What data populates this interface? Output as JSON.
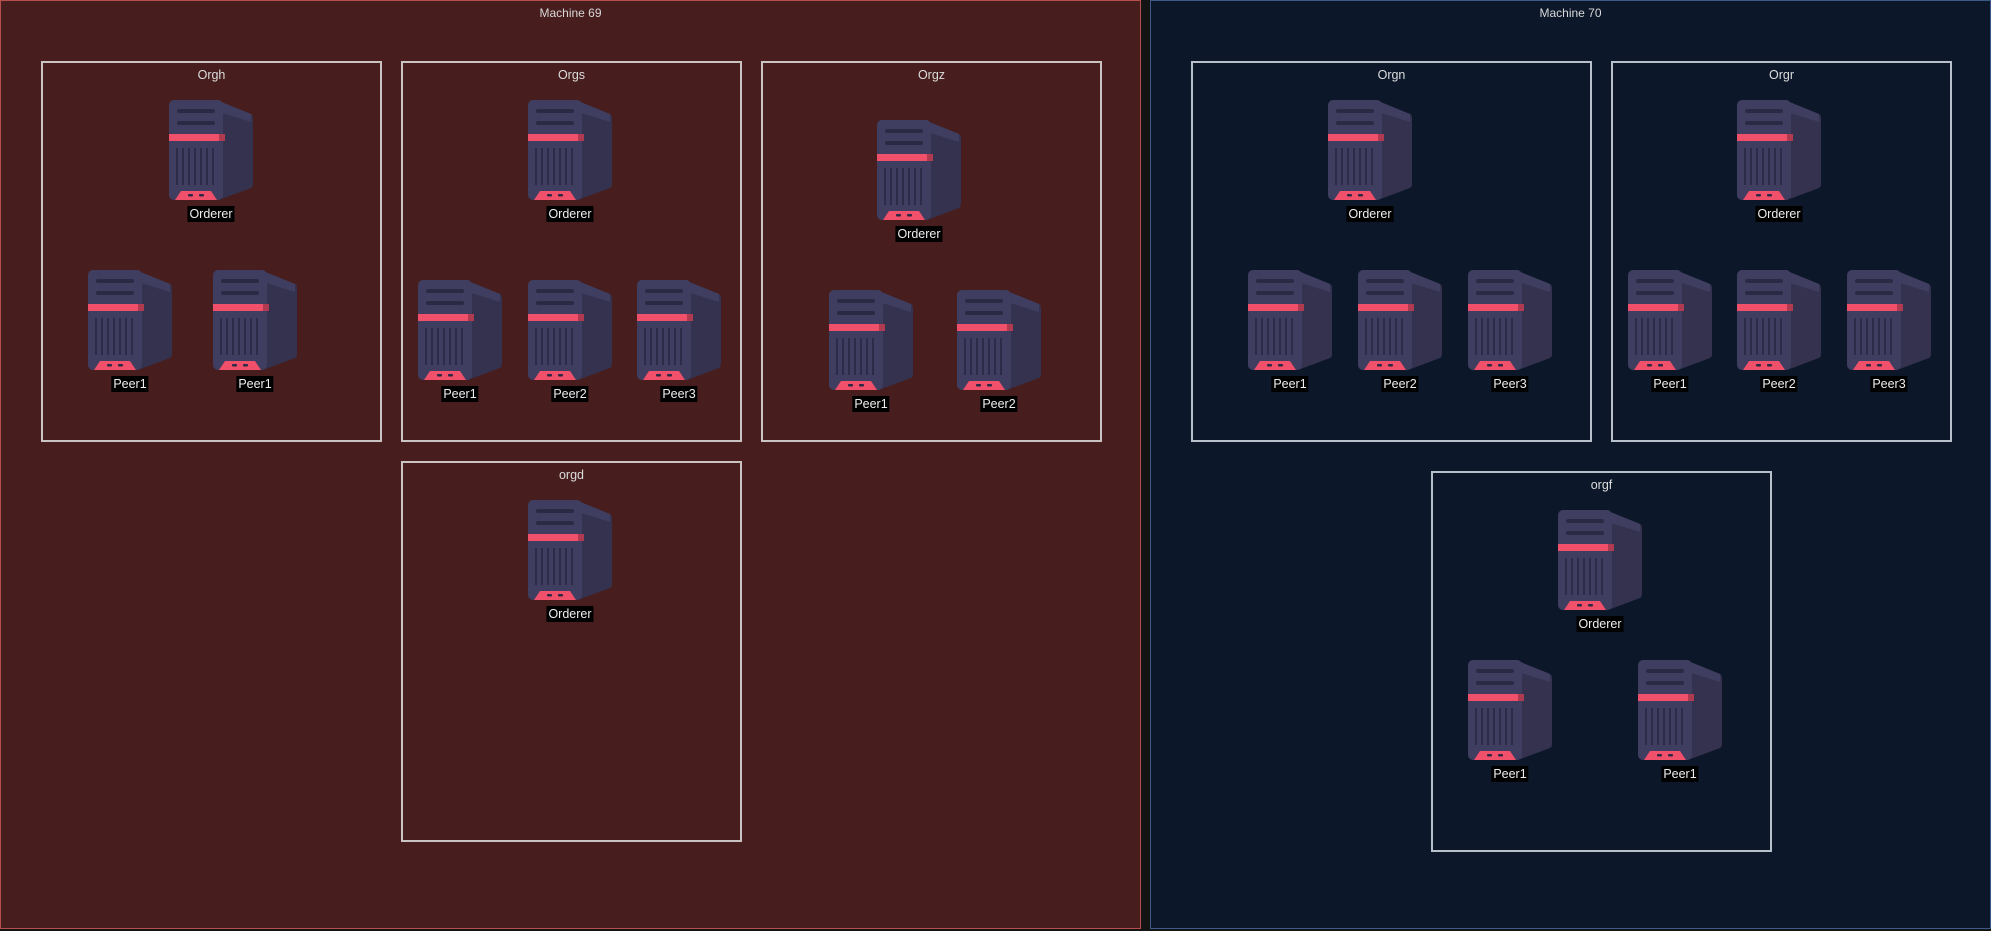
{
  "machines": [
    {
      "title": "Machine 69",
      "color": "#471d1d",
      "orgs": [
        {
          "name": "Orgh",
          "nodes": [
            "Orderer",
            "Peer1",
            "Peer1"
          ]
        },
        {
          "name": "Orgs",
          "nodes": [
            "Orderer",
            "Peer1",
            "Peer2",
            "Peer3"
          ]
        },
        {
          "name": "Orgz",
          "nodes": [
            "Orderer",
            "Peer1",
            "Peer2"
          ]
        },
        {
          "name": "orgd",
          "nodes": [
            "Orderer"
          ]
        }
      ]
    },
    {
      "title": "Machine 70",
      "color": "#0c172a",
      "orgs": [
        {
          "name": "Orgn",
          "nodes": [
            "Orderer",
            "Peer1",
            "Peer2",
            "Peer3"
          ]
        },
        {
          "name": "Orgr",
          "nodes": [
            "Orderer",
            "Peer1",
            "Peer2",
            "Peer3"
          ]
        },
        {
          "name": "orgf",
          "nodes": [
            "Orderer",
            "Peer1",
            "Peer1"
          ]
        }
      ]
    }
  ],
  "icons": {
    "node": "server-icon"
  }
}
